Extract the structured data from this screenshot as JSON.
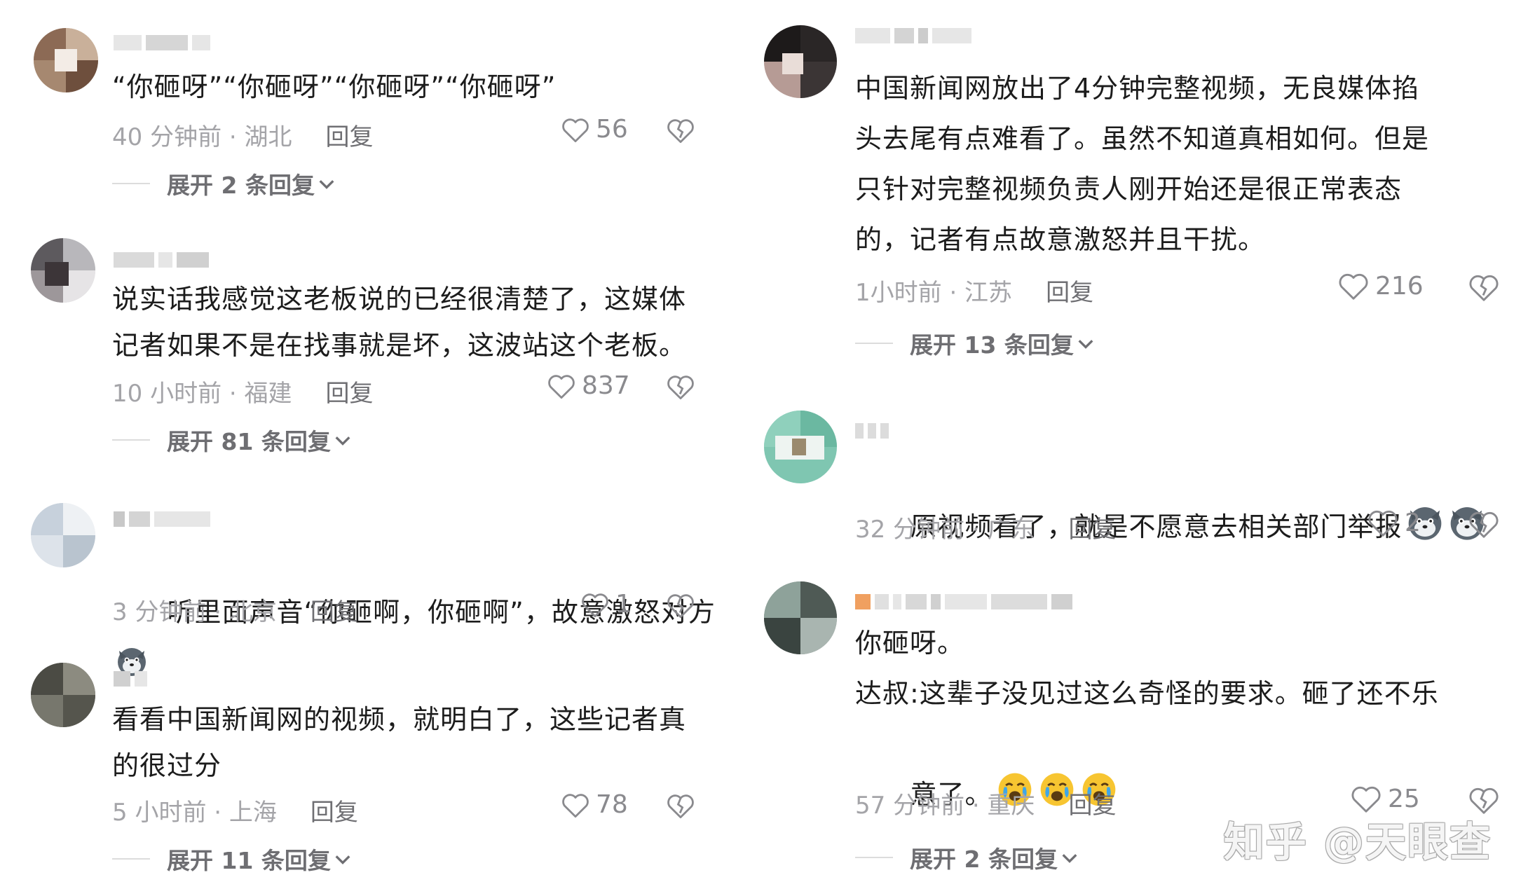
{
  "left_comments": [
    {
      "text": "“你砸呀”“你砸呀”“你砸呀”“你砸呀”",
      "meta_time": "40 分钟前 · 湖北",
      "reply": "回复",
      "likes": "56",
      "expand": "展开 2 条回复"
    },
    {
      "text": "说实话我感觉这老板说的已经很清楚了，这媒体\n记者如果不是在找事就是坏，这波站这个老板。",
      "meta_time": "10 小时前 · 福建",
      "reply": "回复",
      "likes": "837",
      "expand": "展开 81 条回复"
    },
    {
      "text": "听里面声音“你砸啊，你砸啊”，故意激怒对方",
      "meta_time": "3 分钟前 · 北京",
      "reply": "回复",
      "likes": "1"
    },
    {
      "text": "看看中国新闻网的视频，就明白了，这些记者真\n的很过分",
      "meta_time": "5 小时前 · 上海",
      "reply": "回复",
      "likes": "78",
      "expand": "展开 11 条回复"
    }
  ],
  "right_comments": [
    {
      "text": "中国新闻网放出了4分钟完整视频，无良媒体掐\n头去尾有点难看了。虽然不知道真相如何。但是\n只针对完整视频负责人刚开始还是很正常表态\n的，记者有点故意激怒并且干扰。",
      "meta_time": "1小时前 · 江苏",
      "reply": "回复",
      "likes": "216",
      "expand": "展开 13 条回复"
    },
    {
      "text": "原视频看了，就是不愿意去相关部门举报",
      "meta_time": "32 分钟前 · 广东",
      "reply": "回复",
      "likes": "2"
    },
    {
      "text_line1": "你砸呀。",
      "text_line2": "达叔:这辈子没见过这么奇怪的要求。砸了还不乐",
      "text_line3": "意了。",
      "meta_time": "57 分钟前 · 重庆",
      "reply": "回复",
      "likes": "25",
      "expand": "展开 2 条回复"
    }
  ],
  "watermark": "知乎 @天眼查",
  "icons": {
    "like": "heart-outline-icon",
    "dislike": "broken-heart-icon",
    "expand": "chevron-down-icon",
    "emoji_wolf": "wolf-emoji",
    "emoji_cry": "crying-face-emoji"
  },
  "colors": {
    "meta_text": "#a4a4a8",
    "reply_text": "#6f6f73",
    "body_text": "#1c1c1c"
  }
}
